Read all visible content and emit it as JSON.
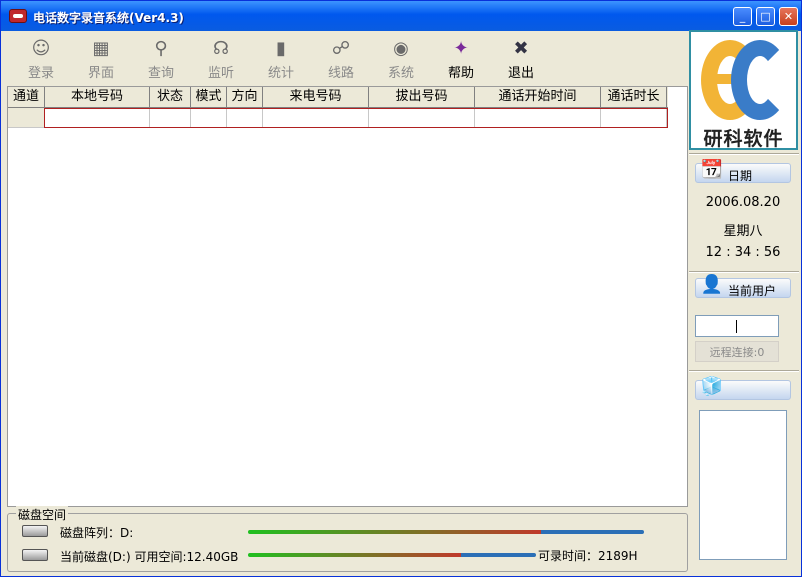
{
  "window": {
    "title": "电话数字录音系统(Ver4.3)",
    "controls": {
      "minimize": "_",
      "maximize": "□",
      "close": "✕"
    }
  },
  "toolbar": {
    "items": [
      {
        "label": "登录",
        "icon": "login-icon",
        "glyph": "☺",
        "enabled": false
      },
      {
        "label": "界面",
        "icon": "interface-icon",
        "glyph": "▦",
        "enabled": false
      },
      {
        "label": "查询",
        "icon": "query-icon",
        "glyph": "⚲",
        "enabled": false
      },
      {
        "label": "监听",
        "icon": "headset-icon",
        "glyph": "☊",
        "enabled": false
      },
      {
        "label": "统计",
        "icon": "statistics-icon",
        "glyph": "▮",
        "enabled": false
      },
      {
        "label": "线路",
        "icon": "line-icon",
        "glyph": "☍",
        "enabled": false
      },
      {
        "label": "系统",
        "icon": "system-icon",
        "glyph": "◉",
        "enabled": false
      },
      {
        "label": "帮助",
        "icon": "help-book-icon",
        "glyph": "✦",
        "enabled": true
      },
      {
        "label": "退出",
        "icon": "exit-icon",
        "glyph": "✖",
        "enabled": true
      }
    ]
  },
  "grid": {
    "columns": [
      "通道",
      "本地号码",
      "状态",
      "模式",
      "方向",
      "来电号码",
      "拔出号码",
      "通话开始时间",
      "通话时长"
    ],
    "rows": [
      [
        "",
        "",
        "",
        "",
        "",
        "",
        "",
        "",
        ""
      ]
    ]
  },
  "disk": {
    "legend": "磁盘空间",
    "array_label": "磁盘阵列：D:",
    "current_label": "当前磁盘(D:) 可用空间:12.40GB",
    "record_time": "可录时间：2189H",
    "array_used_fraction": 0.74,
    "current_used_fraction": 0.74,
    "colors": {
      "used": "#c0392b",
      "free": "#2b6fb6",
      "edge": "#20c020"
    }
  },
  "logo": {
    "brand": "研科软件",
    "colors": {
      "e": "#f2b436",
      "c": "#3a7cc8"
    }
  },
  "date_panel": {
    "title": "日期",
    "date": "2006.08.20",
    "weekday": "星期八",
    "time": "12 : 34 : 56"
  },
  "user_panel": {
    "title": "当前用户",
    "user_value": "",
    "remote_label": "远程连接:0"
  },
  "misc_panel": {
    "icon": "cubes-icon"
  }
}
